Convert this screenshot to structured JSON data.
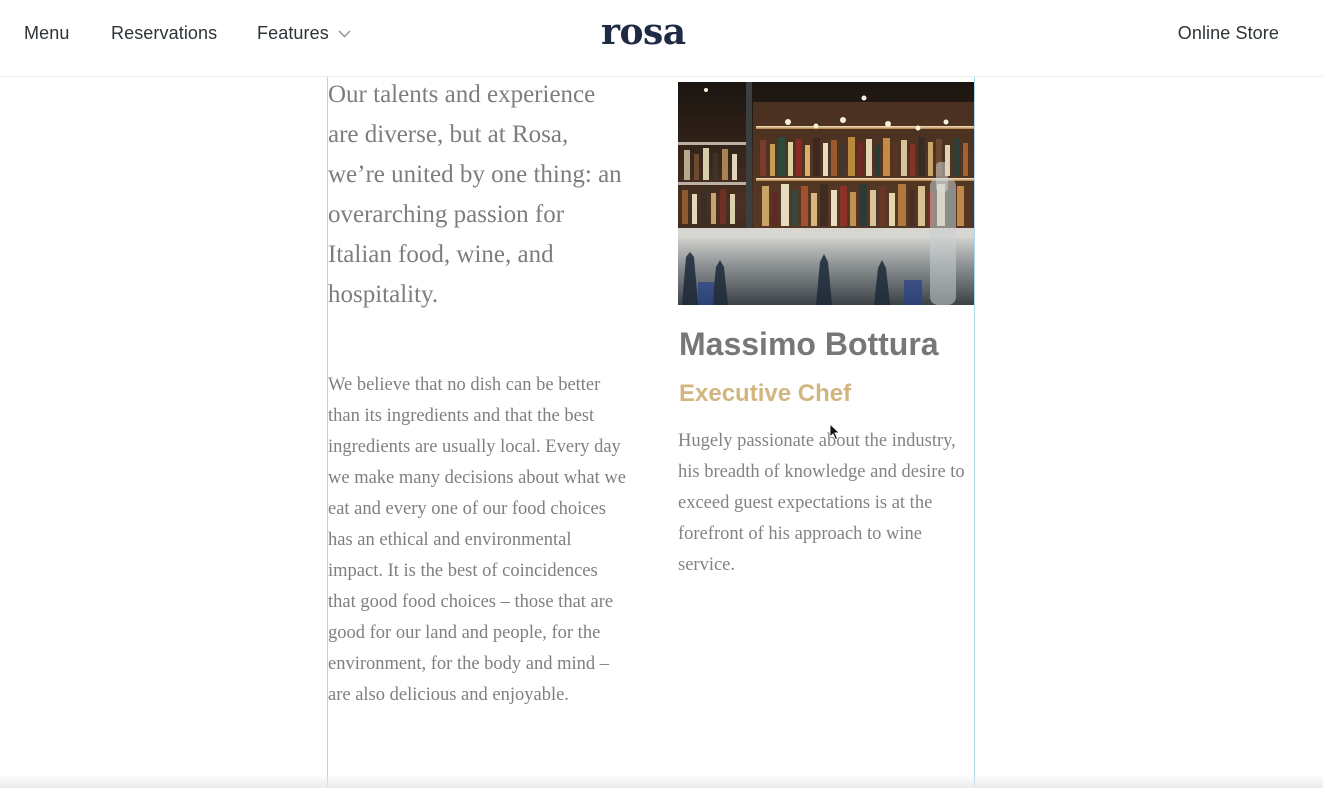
{
  "nav": {
    "menu": "Menu",
    "reservations": "Reservations",
    "features": "Features",
    "online_store": "Online Store"
  },
  "brand": {
    "logo_text": "rosa",
    "logo_color": "#1f2b45"
  },
  "intro": {
    "lead": "Our talents and experience are diverse, but at Rosa, we’re united by one thing: an overarching passion for Italian food, wine, and hospitality.",
    "body": "We believe that no dish can be better than its ingredients and that the best ingredients are usually local. Every day we make many decisions about what we eat and every one of our food choices has an ethical and environmental impact. It is the best of coincidences that good food choices – those that are good for our land and people, for the environment, for the body and mind – are also delicious and enjoyable."
  },
  "chef": {
    "name": "Massimo Bottura",
    "role": "Executive Chef",
    "bio": "Hugely passionate about the industry, his breadth of knowledge and desire to exceed guest expectations is at the forefront of his approach to wine service."
  },
  "colors": {
    "accent_gold": "#d3b57f",
    "text_gray": "#7b7e80",
    "nav_text": "#2d3438",
    "guide_blue": "#aed8ee"
  },
  "icons": {
    "features_dropdown": "chevron-down-icon",
    "pointer": "mouse-cursor-icon"
  }
}
